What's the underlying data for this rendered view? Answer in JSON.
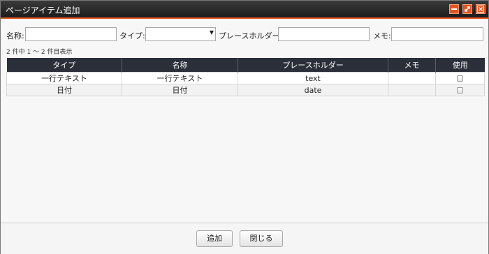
{
  "window": {
    "title": "ページアイテム追加",
    "accent_color": "#e8541e",
    "controls": [
      "minimize-icon",
      "maximize-icon",
      "close-icon"
    ]
  },
  "filters": {
    "name_label": "名称:",
    "name_value": "",
    "type_label": "タイプ:",
    "type_value": "",
    "placeholder_label": "プレースホルダー:",
    "placeholder_value": "",
    "memo_label": "メモ:",
    "memo_value": ""
  },
  "result_count": "2 件中 1 ～ 2 件目表示",
  "table": {
    "headers": [
      "タイプ",
      "名称",
      "プレースホルダー",
      "メモ",
      "使用"
    ],
    "rows": [
      {
        "type": "一行テキスト",
        "name": "一行テキスト",
        "placeholder": "text",
        "memo": "",
        "use": false
      },
      {
        "type": "日付",
        "name": "日付",
        "placeholder": "date",
        "memo": "",
        "use": false
      }
    ]
  },
  "footer": {
    "add_label": "追加",
    "close_label": "閉じる"
  }
}
